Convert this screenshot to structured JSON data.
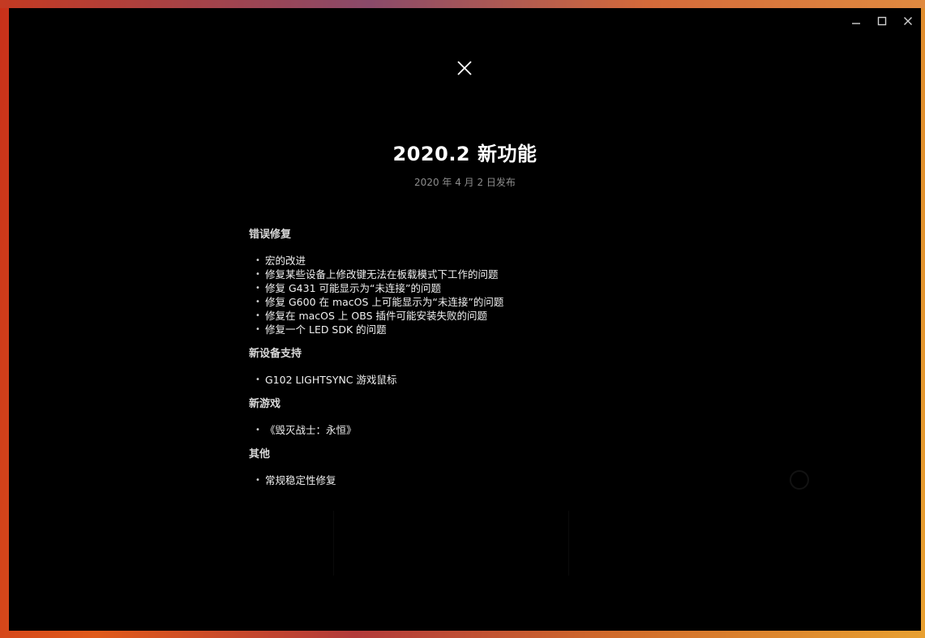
{
  "window": {
    "controls": {
      "minimize_icon": "minimize-icon",
      "maximize_icon": "maximize-icon",
      "close_icon": "close-icon"
    }
  },
  "modal": {
    "close_icon": "close-icon",
    "title": "2020.2 新功能",
    "release_date": "2020 年 4 月 2 日发布",
    "sections": [
      {
        "heading": "错误修复",
        "items": [
          "宏的改进",
          "修复某些设备上修改键无法在板载模式下工作的问题",
          "修复 G431 可能显示为“未连接”的问题",
          "修复 G600 在 macOS 上可能显示为“未连接”的问题",
          "修复在 macOS 上 OBS 插件可能安装失败的问题",
          "修复一个 LED SDK 的问题"
        ]
      },
      {
        "heading": "新设备支持",
        "items": [
          "G102 LIGHTSYNC 游戏鼠标"
        ]
      },
      {
        "heading": "新游戏",
        "items": [
          "《毁灭战士：永恒》"
        ]
      },
      {
        "heading": "其他",
        "items": [
          "常规稳定性修复"
        ]
      }
    ]
  },
  "colors": {
    "background": "#000000",
    "title": "#ffffff",
    "subtitle": "#8c8c8c",
    "body_text": "#f0f0f0"
  }
}
